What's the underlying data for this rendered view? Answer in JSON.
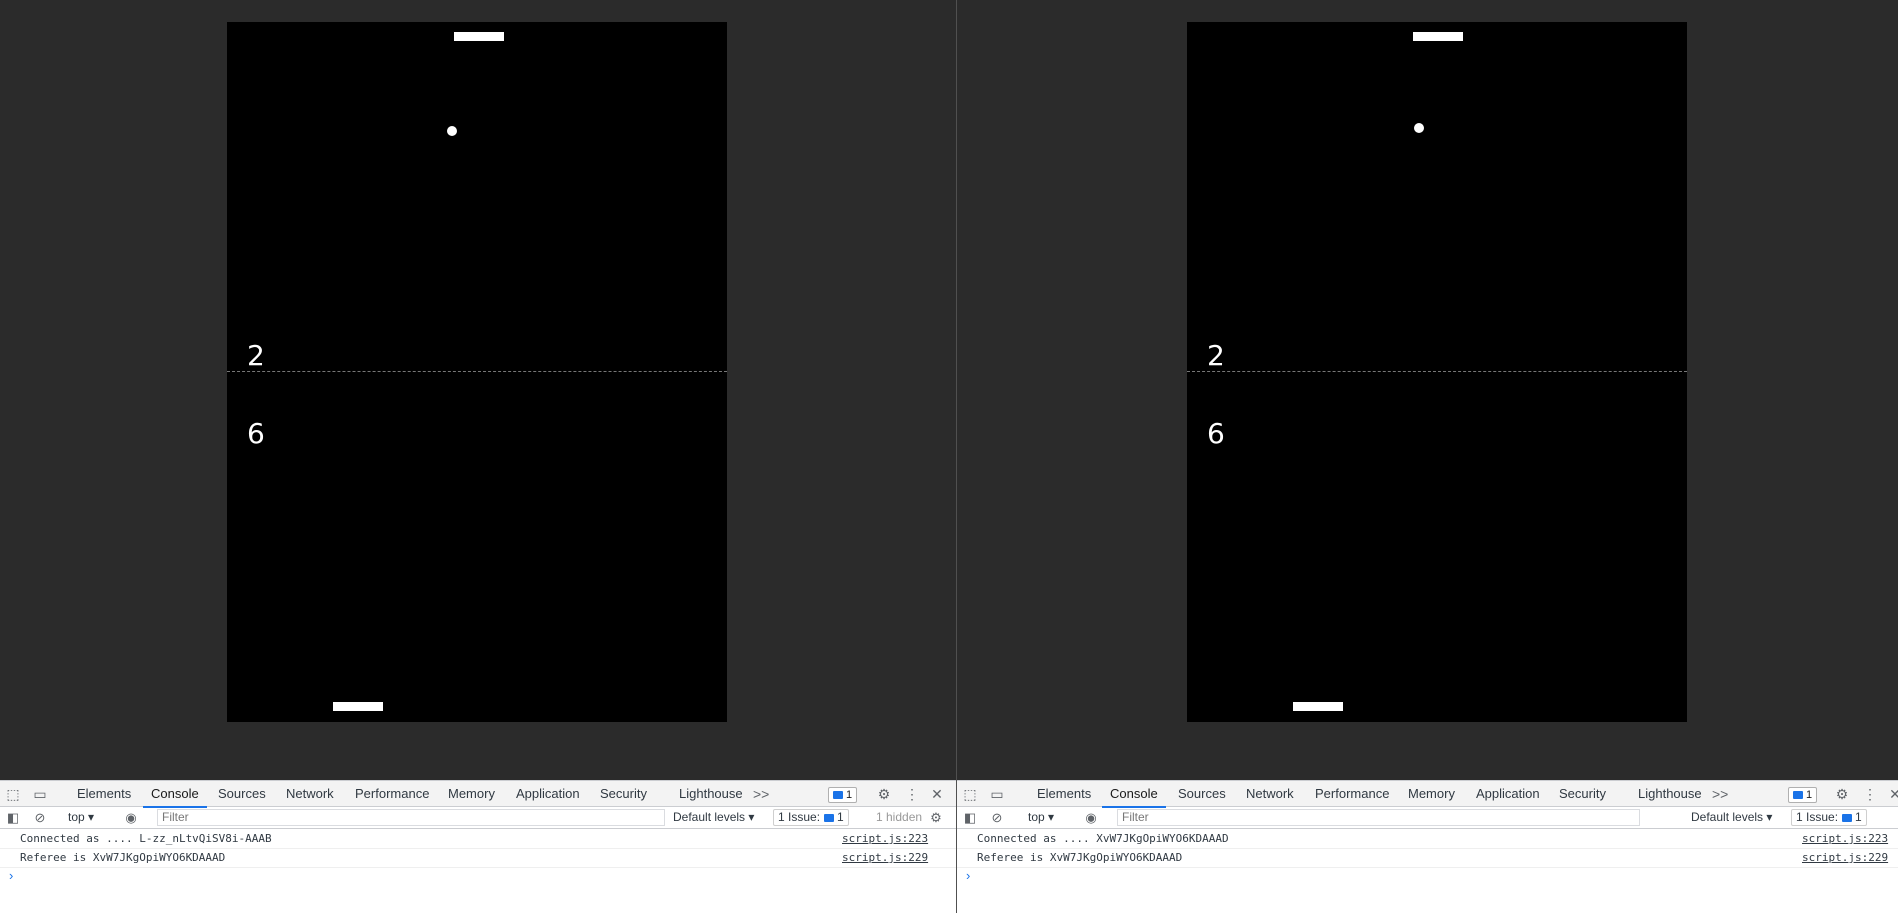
{
  "left": {
    "score_top": "2",
    "score_bottom": "6",
    "tabs": [
      "Elements",
      "Console",
      "Sources",
      "Network",
      "Performance",
      "Memory",
      "Application",
      "Security",
      "Lighthouse"
    ],
    "active_tab": "Console",
    "more_tabs": ">>",
    "message_badge_count": "1",
    "context": "top",
    "filter_placeholder": "Filter",
    "levels": "Default levels",
    "issues_label": "1 Issue:",
    "issues_count": "1",
    "hidden_label": "1 hidden",
    "messages": [
      {
        "text": "Connected as .... L-zz_nLtvQiSV8i-AAAB",
        "source": "script.js:223"
      },
      {
        "text": "Referee is XvW7JKgOpiWYO6KDAAAD",
        "source": "script.js:229"
      }
    ]
  },
  "right": {
    "score_top": "2",
    "score_bottom": "6",
    "tabs": [
      "Elements",
      "Console",
      "Sources",
      "Network",
      "Performance",
      "Memory",
      "Application",
      "Security",
      "Lighthouse"
    ],
    "active_tab": "Console",
    "more_tabs": ">>",
    "message_badge_count": "1",
    "context": "top",
    "filter_placeholder": "Filter",
    "levels": "Default levels",
    "issues_label": "1 Issue:",
    "issues_count": "1",
    "messages": [
      {
        "text": "Connected as .... XvW7JKgOpiWYO6KDAAAD",
        "source": "script.js:223"
      },
      {
        "text": "Referee is XvW7JKgOpiWYO6KDAAAD",
        "source": "script.js:229"
      }
    ]
  },
  "icons": {
    "inspect": "inspect-element-icon",
    "device": "device-toolbar-icon",
    "settings": "gear-icon",
    "more": "more-vertical-icon",
    "close": "close-icon",
    "sidebar": "sidebar-toggle-icon",
    "clear": "clear-console-icon",
    "eye": "live-expression-eye-icon",
    "message": "message-icon",
    "prompt": "console-prompt-chevron-icon"
  }
}
